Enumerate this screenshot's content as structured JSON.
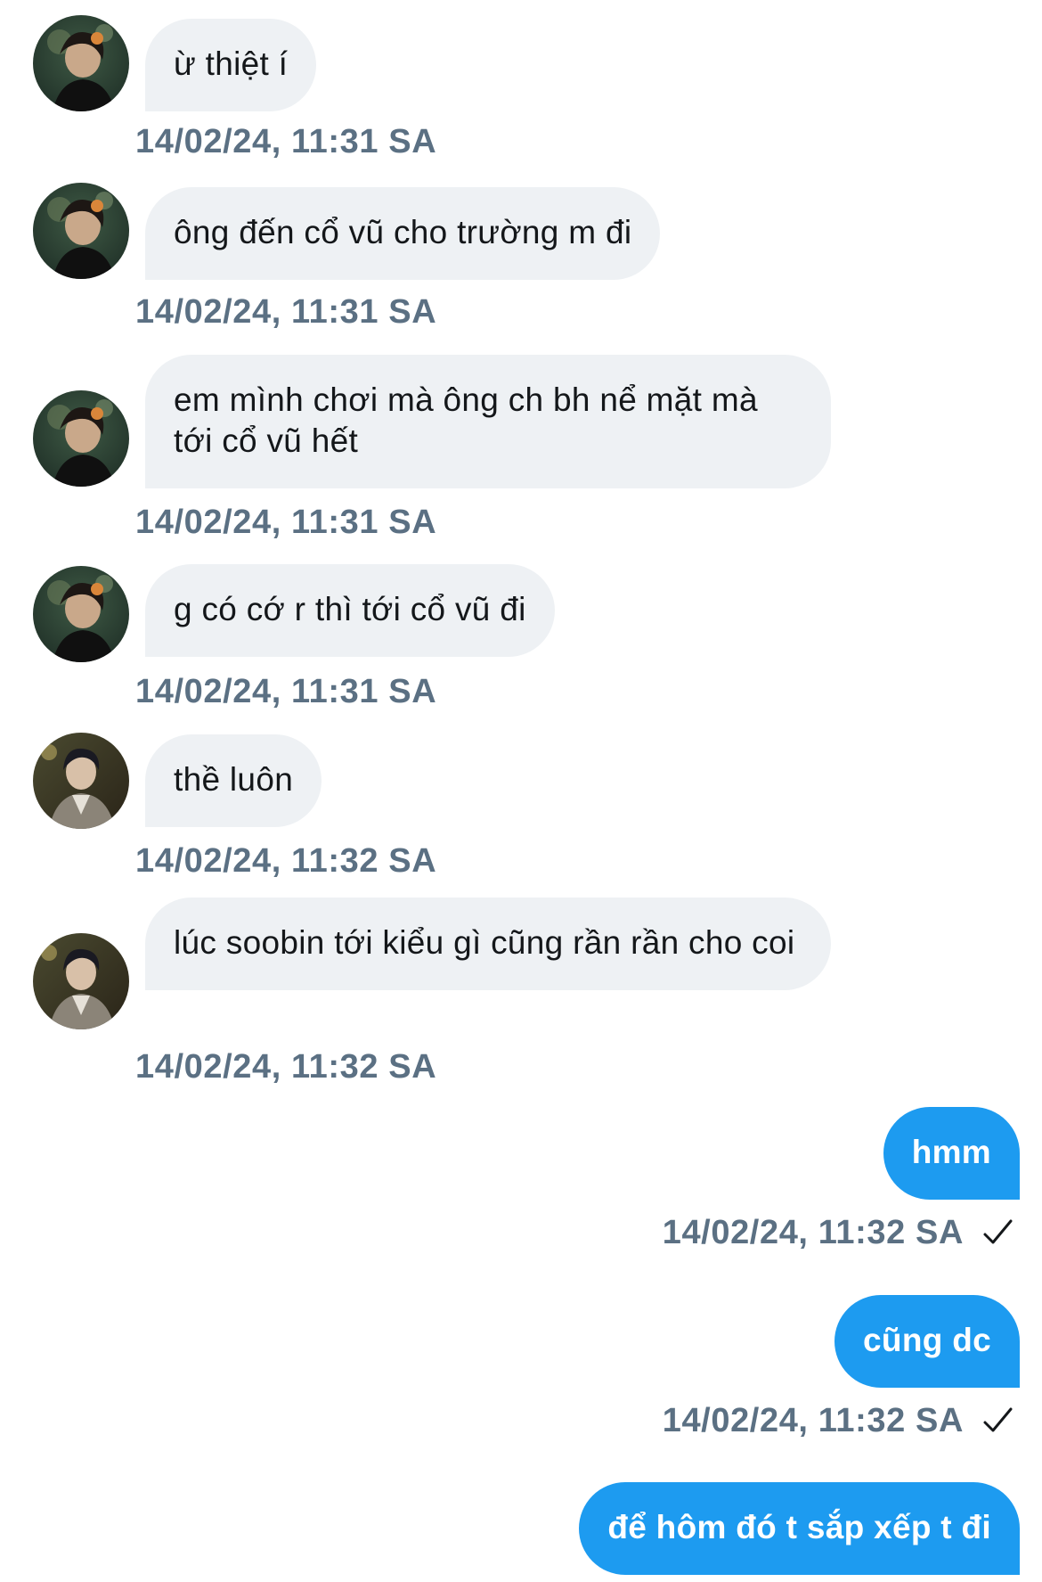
{
  "messages": [
    {
      "direction": "in",
      "text": "ừ thiệt í",
      "timestamp": "14/02/24, 11:31 SA",
      "avatar": "avatar-a"
    },
    {
      "direction": "in",
      "text": "ông đến cổ vũ cho trường m đi",
      "timestamp": "14/02/24, 11:31 SA",
      "avatar": "avatar-a"
    },
    {
      "direction": "in",
      "text": "em mình chơi mà ông ch bh nể mặt mà tới cổ vũ hết",
      "timestamp": "14/02/24, 11:31 SA",
      "avatar": "avatar-a"
    },
    {
      "direction": "in",
      "text": "g có cớ r thì tới cổ vũ đi",
      "timestamp": "14/02/24, 11:31 SA",
      "avatar": "avatar-a"
    },
    {
      "direction": "in",
      "text": "thề luôn",
      "timestamp": "14/02/24, 11:32 SA",
      "avatar": "avatar-b"
    },
    {
      "direction": "in",
      "text": "lúc soobin tới kiểu gì cũng rần rần cho coi",
      "timestamp": "14/02/24, 11:32 SA",
      "avatar": "avatar-b"
    },
    {
      "direction": "out",
      "text": "hmm",
      "timestamp": "14/02/24, 11:32 SA",
      "status_icon": "check-icon"
    },
    {
      "direction": "out",
      "text": "cũng dc",
      "timestamp": "14/02/24, 11:32 SA",
      "status_icon": "check-icon"
    },
    {
      "direction": "out",
      "text": "để hôm đó t sắp xếp t đi"
    }
  ],
  "colors": {
    "incoming_bubble": "#eef1f4",
    "outgoing_bubble": "#1d9bf0",
    "timestamp": "#5b7083",
    "incoming_text": "#14171a",
    "outgoing_text": "#ffffff"
  }
}
